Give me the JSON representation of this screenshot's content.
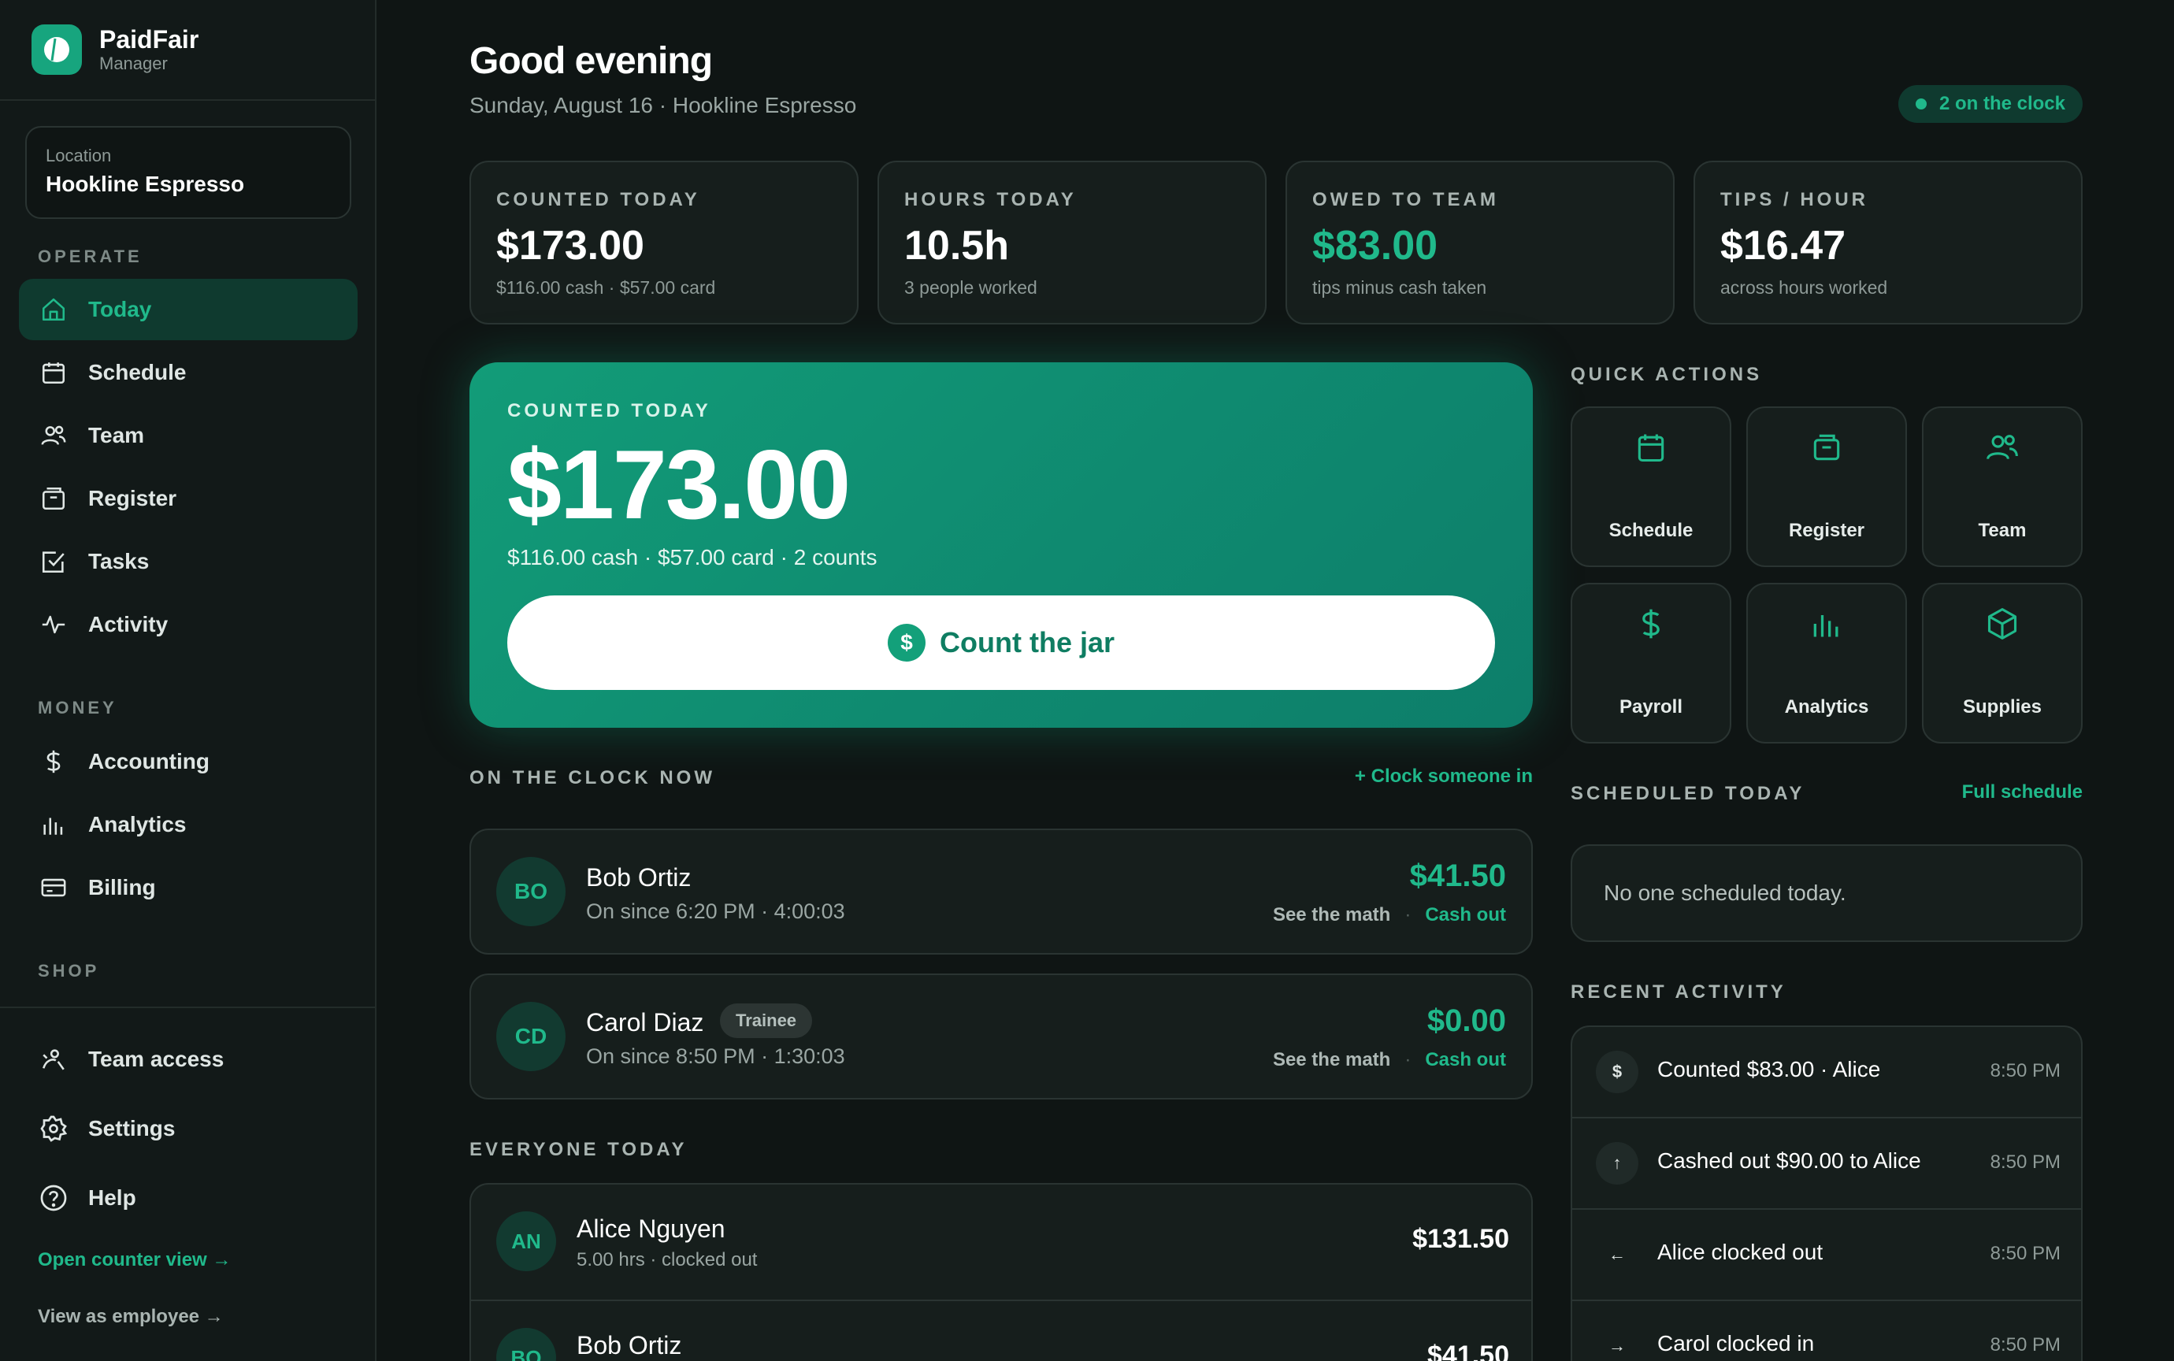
{
  "app": {
    "name": "PaidFair",
    "role": "Manager"
  },
  "location": {
    "label": "Location",
    "value": "Hookline Espresso"
  },
  "sidebar": {
    "sections": {
      "operate": "OPERATE",
      "money": "MONEY",
      "shop": "SHOP"
    },
    "operate_items": [
      {
        "label": "Today",
        "icon": "home-icon"
      },
      {
        "label": "Schedule",
        "icon": "calendar-icon"
      },
      {
        "label": "Team",
        "icon": "users-icon"
      },
      {
        "label": "Register",
        "icon": "register-icon"
      },
      {
        "label": "Tasks",
        "icon": "checkbox-icon"
      },
      {
        "label": "Activity",
        "icon": "pulse-icon"
      }
    ],
    "money_items": [
      {
        "label": "Accounting",
        "icon": "dollar-icon"
      },
      {
        "label": "Analytics",
        "icon": "bar-chart-icon"
      },
      {
        "label": "Billing",
        "icon": "card-icon"
      }
    ],
    "bottom_items": [
      {
        "label": "Team access",
        "icon": "team-access-icon"
      },
      {
        "label": "Settings",
        "icon": "gear-icon"
      },
      {
        "label": "Help",
        "icon": "help-icon"
      }
    ],
    "open_counter": "Open counter view →",
    "view_employee": "View as employee →"
  },
  "header": {
    "greeting": "Good evening",
    "subline": "Sunday, August 16 · Hookline Espresso",
    "clock_pill": "2 on the clock"
  },
  "stats": [
    {
      "label": "COUNTED TODAY",
      "value": "$173.00",
      "sub": "$116.00 cash · $57.00 card",
      "color": "#ffffff"
    },
    {
      "label": "HOURS TODAY",
      "value": "10.5h",
      "sub": "3 people worked",
      "color": "#ffffff"
    },
    {
      "label": "OWED TO TEAM",
      "value": "$83.00",
      "sub": "tips minus cash taken",
      "color": "#20b98b"
    },
    {
      "label": "TIPS / HOUR",
      "value": "$16.47",
      "sub": "across hours worked",
      "color": "#ffffff"
    }
  ],
  "hero": {
    "label": "COUNTED TODAY",
    "amount": "$173.00",
    "sub": "$116.00 cash · $57.00 card · 2 counts",
    "button_icon": "$",
    "button_label": "Count the jar"
  },
  "on_clock": {
    "title": "ON THE CLOCK NOW",
    "action": "+ Clock someone in",
    "people": [
      {
        "initials": "BO",
        "name": "Bob Ortiz",
        "meta": "On since 6:20 PM · 4:00:03",
        "amount": "$41.50",
        "math": "See the math",
        "sep": "·",
        "cashout": "Cash out",
        "badge": ""
      },
      {
        "initials": "CD",
        "name": "Carol Diaz",
        "meta": "On since 8:50 PM · 1:30:03",
        "amount": "$0.00",
        "math": "See the math",
        "sep": "·",
        "cashout": "Cash out",
        "badge": "Trainee"
      }
    ]
  },
  "everyone": {
    "title": "EVERYONE TODAY",
    "people": [
      {
        "initials": "AN",
        "name": "Alice Nguyen",
        "meta": "5.00 hrs · clocked out",
        "amount": "$131.50"
      },
      {
        "initials": "BO",
        "name": "Bob Ortiz",
        "meta": "",
        "amount": "$41.50"
      }
    ]
  },
  "quick_actions": {
    "title": "QUICK ACTIONS",
    "tiles": [
      {
        "label": "Schedule",
        "icon": "calendar-icon"
      },
      {
        "label": "Register",
        "icon": "register-icon"
      },
      {
        "label": "Team",
        "icon": "users-icon"
      },
      {
        "label": "Payroll",
        "icon": "dollar-icon"
      },
      {
        "label": "Analytics",
        "icon": "bar-chart-icon"
      },
      {
        "label": "Supplies",
        "icon": "box-icon"
      }
    ]
  },
  "scheduled": {
    "title": "SCHEDULED TODAY",
    "link": "Full schedule",
    "empty": "No one scheduled today."
  },
  "activity": {
    "title": "RECENT ACTIVITY",
    "items": [
      {
        "icon": "$",
        "text": "Counted $83.00 · Alice",
        "time": "8:50 PM"
      },
      {
        "icon": "↑",
        "text": "Cashed out $90.00 to Alice",
        "time": "8:50 PM"
      },
      {
        "icon": "←",
        "text": "Alice clocked out",
        "time": "8:50 PM"
      },
      {
        "icon": "→",
        "text": "Carol clocked in",
        "time": "8:50 PM"
      }
    ]
  },
  "colors": {
    "accent": "#20b98b",
    "background": "#0f1514",
    "card": "#161e1c"
  }
}
